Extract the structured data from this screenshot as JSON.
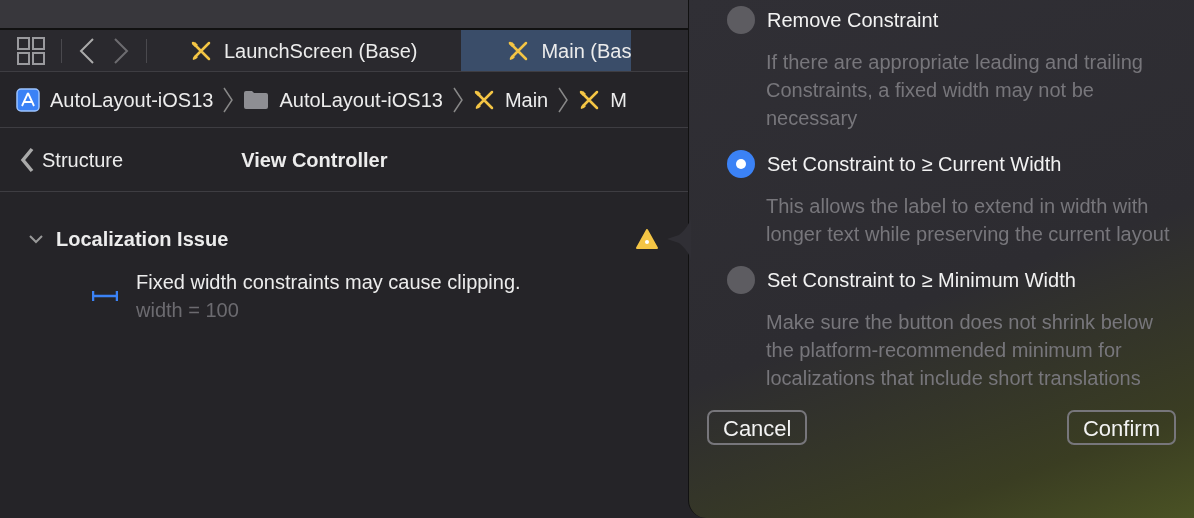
{
  "tabs": [
    {
      "label": "LaunchScreen (Base)",
      "selected": false
    },
    {
      "label": "Main (Bas",
      "selected": true
    }
  ],
  "breadcrumb": [
    {
      "label": "AutoLayout-iOS13",
      "kind": "project"
    },
    {
      "label": "AutoLayout-iOS13",
      "kind": "folder"
    },
    {
      "label": "Main",
      "kind": "storyboard"
    },
    {
      "label": "M",
      "kind": "storyboard"
    }
  ],
  "header": {
    "back": "Structure",
    "title": "View Controller"
  },
  "issue": {
    "title": "Localization Issue",
    "expanded": true,
    "items": [
      {
        "message": "Fixed width constraints may cause clipping.",
        "detail": "width = 100"
      }
    ]
  },
  "popover": {
    "options": [
      {
        "label": "Remove Constraint",
        "description": "If there are appropriate leading and trailing Constraints, a fixed width may not be necessary",
        "selected": false
      },
      {
        "label": "Set Constraint to ≥ Current Width",
        "description": "This allows the label to extend in width with longer text while preserving the current layout",
        "selected": true
      },
      {
        "label": "Set Constraint to ≥ Minimum Width",
        "description": "Make sure the button does not shrink below the platform-recommended minimum for localizations that include short translations",
        "selected": false
      }
    ],
    "buttons": [
      "Cancel",
      "Confirm"
    ]
  }
}
